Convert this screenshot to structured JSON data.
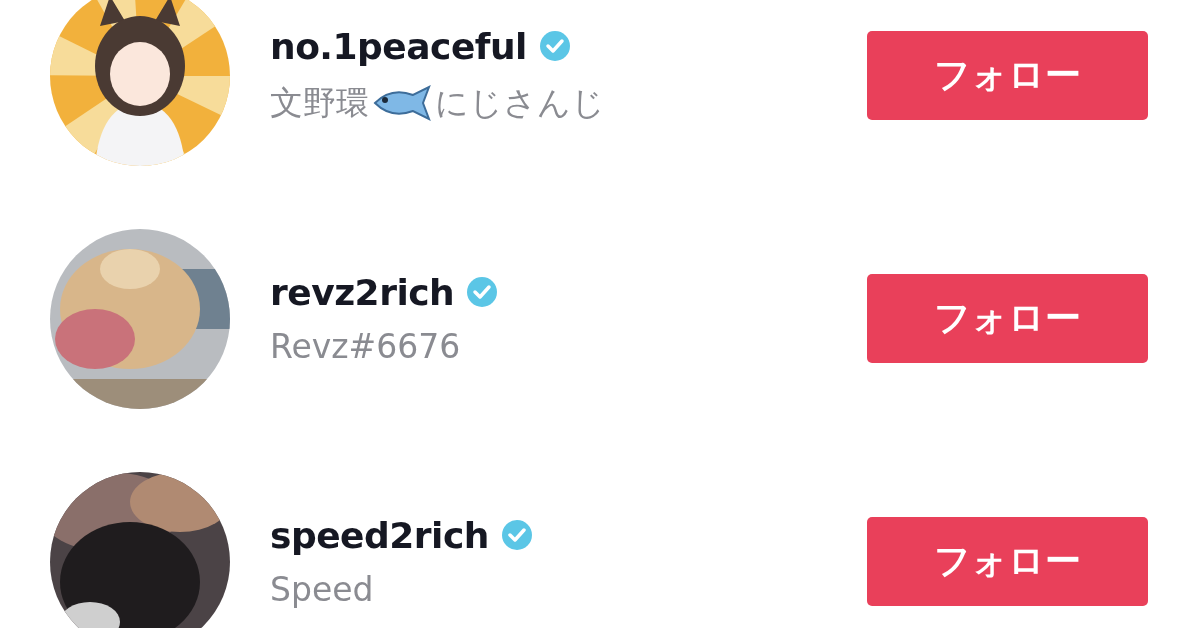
{
  "users": [
    {
      "username": "no.1peaceful",
      "verified": true,
      "bio": "文野環",
      "has_emoji": true,
      "bio_suffix": "にじさんじ",
      "button": "フォロー"
    },
    {
      "username": "revz2rich",
      "verified": true,
      "bio": "Revz#6676",
      "has_emoji": false,
      "button": "フォロー"
    },
    {
      "username": "speed2rich",
      "verified": true,
      "bio": "Speed",
      "has_emoji": false,
      "button": "フォロー"
    }
  ]
}
